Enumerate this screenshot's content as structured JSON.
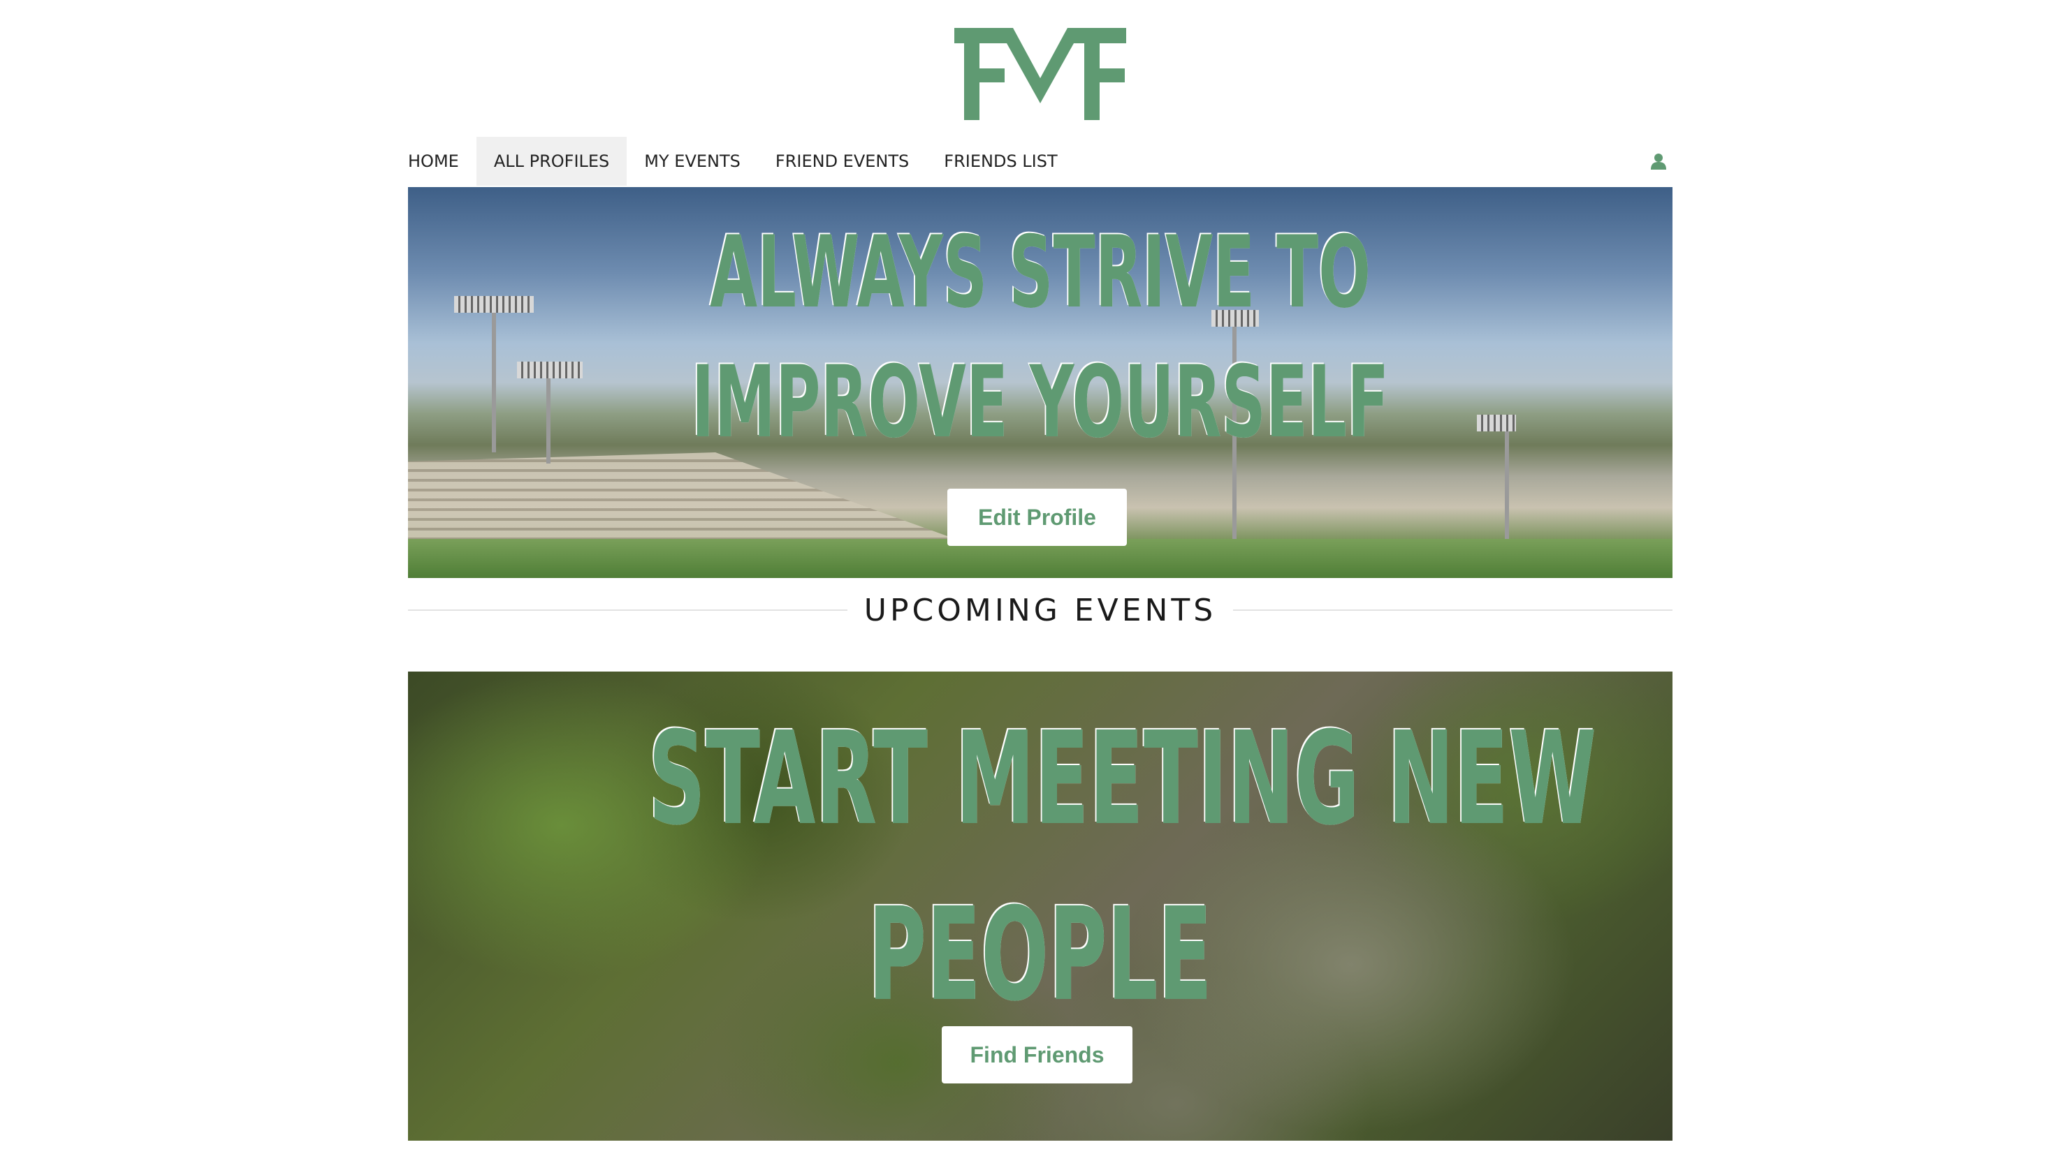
{
  "brand": {
    "logo_text": "FMF",
    "accent_color": "#5f9a72"
  },
  "nav": {
    "items": [
      {
        "label": "HOME",
        "active": false
      },
      {
        "label": "ALL PROFILES",
        "active": true
      },
      {
        "label": "MY EVENTS",
        "active": false
      },
      {
        "label": "FRIEND EVENTS",
        "active": false
      },
      {
        "label": "FRIENDS LIST",
        "active": false
      }
    ],
    "user_icon": "user-icon"
  },
  "hero": {
    "headline_line1": "ALWAYS STRIVE TO",
    "headline_line2": "IMPROVE YOURSELF",
    "button_label": "Edit Profile"
  },
  "upcoming": {
    "title": "UPCOMING EVENTS"
  },
  "meet": {
    "headline_line1": "START MEETING NEW",
    "headline_line2": "PEOPLE",
    "button_label": "Find Friends"
  }
}
